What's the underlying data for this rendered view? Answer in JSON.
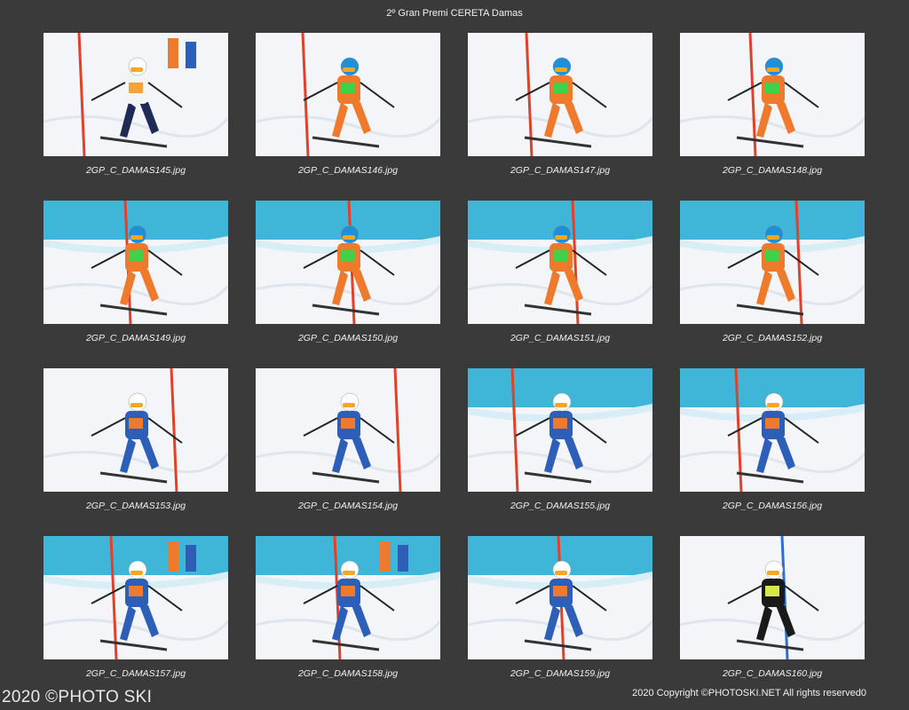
{
  "page": {
    "title": "2º Gran Premi CERETA Damas",
    "watermark": "2020 ©PHOTO SKI",
    "copyright": "2020 Copyright ©PHOTOSKI.NET All rights reserved",
    "page_number": "0"
  },
  "thumbnails": [
    {
      "filename": "2GP_C_DAMAS145.jpg",
      "bg": "snow-crowd",
      "suit": "white"
    },
    {
      "filename": "2GP_C_DAMAS146.jpg",
      "bg": "snow",
      "suit": "orange"
    },
    {
      "filename": "2GP_C_DAMAS147.jpg",
      "bg": "snow",
      "suit": "orange"
    },
    {
      "filename": "2GP_C_DAMAS148.jpg",
      "bg": "snow",
      "suit": "orange"
    },
    {
      "filename": "2GP_C_DAMAS149.jpg",
      "bg": "net",
      "suit": "orange"
    },
    {
      "filename": "2GP_C_DAMAS150.jpg",
      "bg": "net",
      "suit": "orange"
    },
    {
      "filename": "2GP_C_DAMAS151.jpg",
      "bg": "net",
      "suit": "orange"
    },
    {
      "filename": "2GP_C_DAMAS152.jpg",
      "bg": "net",
      "suit": "orange"
    },
    {
      "filename": "2GP_C_DAMAS153.jpg",
      "bg": "snow",
      "suit": "blue"
    },
    {
      "filename": "2GP_C_DAMAS154.jpg",
      "bg": "snow",
      "suit": "blue"
    },
    {
      "filename": "2GP_C_DAMAS155.jpg",
      "bg": "net",
      "suit": "blue"
    },
    {
      "filename": "2GP_C_DAMAS156.jpg",
      "bg": "net",
      "suit": "blue"
    },
    {
      "filename": "2GP_C_DAMAS157.jpg",
      "bg": "net-crowd",
      "suit": "blue"
    },
    {
      "filename": "2GP_C_DAMAS158.jpg",
      "bg": "net-crowd",
      "suit": "blue"
    },
    {
      "filename": "2GP_C_DAMAS159.jpg",
      "bg": "net",
      "suit": "blue"
    },
    {
      "filename": "2GP_C_DAMAS160.jpg",
      "bg": "snow-poles",
      "suit": "black"
    }
  ],
  "colors": {
    "background": "#3a3a3a",
    "snow": "#f3f5f8",
    "net": "#3fb6d8",
    "gate_red": "#e3402a",
    "gate_blue": "#2a6fd6"
  }
}
